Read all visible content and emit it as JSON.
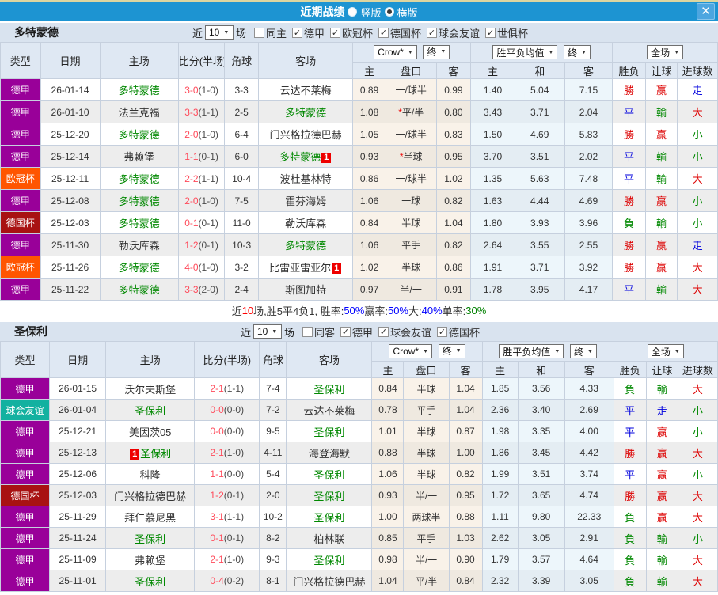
{
  "title_bar": {
    "title": "近期战绩",
    "close_icon": "✕",
    "options": [
      {
        "label": "竖版",
        "selected": false
      },
      {
        "label": "横版",
        "selected": true
      }
    ]
  },
  "columns": {
    "type": "类型",
    "date": "日期",
    "home": "主场",
    "score": "比分(半场)",
    "corner": "角球",
    "away": "客场",
    "crow": "Crow*",
    "end": "终",
    "avg": "胜平负均值",
    "scope": "全场",
    "sub_home": "主",
    "sub_handicap": "盘口",
    "sub_away": "客",
    "sub_avg_home": "主",
    "sub_draw": "和",
    "sub_avg_away": "客",
    "sub_result": "胜负",
    "sub_let": "让球",
    "sub_goals": "进球数"
  },
  "type_colors": {
    "德甲": "#990099",
    "欧冠杯": "#ff5500",
    "德国杯": "#a81212",
    "球会友谊": "#13b1a0"
  },
  "result_colors": {
    "勝": "#dd0000",
    "平": "#0000dd",
    "負": "#008800",
    "赢": "#dd0000",
    "輸": "#008800",
    "走": "#0000dd",
    "大": "#dd0000",
    "小": "#008800"
  },
  "sections": [
    {
      "team": "多特蒙德",
      "filters": {
        "near": "近",
        "count": "10",
        "unit": "场",
        "options": [
          {
            "label": "同主",
            "checked": false
          },
          {
            "label": "德甲",
            "checked": true
          },
          {
            "label": "欧冠杯",
            "checked": true
          },
          {
            "label": "德国杯",
            "checked": true
          },
          {
            "label": "球会友谊",
            "checked": true
          },
          {
            "label": "世俱杯",
            "checked": true
          }
        ]
      },
      "rows": [
        {
          "type": "德甲",
          "date": "26-01-14",
          "home": {
            "name": "多特蒙德",
            "focus": true
          },
          "ft": "3-0",
          "ht": "(1-0)",
          "corner": "3-3",
          "away": {
            "name": "云达不莱梅"
          },
          "crow": [
            "0.89",
            "一/球半",
            "0.99"
          ],
          "avg": [
            "1.40",
            "5.04",
            "7.15"
          ],
          "res": [
            "勝",
            "赢",
            "走"
          ]
        },
        {
          "type": "德甲",
          "date": "26-01-10",
          "home": {
            "name": "法兰克福"
          },
          "ft": "3-3",
          "ht": "(1-1)",
          "corner": "2-5",
          "away": {
            "name": "多特蒙德",
            "focus": true
          },
          "crow": [
            "1.08",
            "*平/半",
            "0.80"
          ],
          "avg": [
            "3.43",
            "3.71",
            "2.04"
          ],
          "res": [
            "平",
            "輸",
            "大"
          ]
        },
        {
          "type": "德甲",
          "date": "25-12-20",
          "home": {
            "name": "多特蒙德",
            "focus": true
          },
          "ft": "2-0",
          "ht": "(1-0)",
          "corner": "6-4",
          "away": {
            "name": "门兴格拉德巴赫"
          },
          "crow": [
            "1.05",
            "一/球半",
            "0.83"
          ],
          "avg": [
            "1.50",
            "4.69",
            "5.83"
          ],
          "res": [
            "勝",
            "赢",
            "小"
          ]
        },
        {
          "type": "德甲",
          "date": "25-12-14",
          "home": {
            "name": "弗赖堡"
          },
          "ft": "1-1",
          "ht": "(0-1)",
          "corner": "6-0",
          "away": {
            "name": "多特蒙德",
            "focus": true,
            "badge": "1",
            "badge_pos": "after"
          },
          "crow": [
            "0.93",
            "*半球",
            "0.95"
          ],
          "avg": [
            "3.70",
            "3.51",
            "2.02"
          ],
          "res": [
            "平",
            "輸",
            "小"
          ]
        },
        {
          "type": "欧冠杯",
          "date": "25-12-11",
          "home": {
            "name": "多特蒙德",
            "focus": true
          },
          "ft": "2-2",
          "ht": "(1-1)",
          "corner": "10-4",
          "away": {
            "name": "波杜基林特"
          },
          "crow": [
            "0.86",
            "一/球半",
            "1.02"
          ],
          "avg": [
            "1.35",
            "5.63",
            "7.48"
          ],
          "res": [
            "平",
            "輸",
            "大"
          ]
        },
        {
          "type": "德甲",
          "date": "25-12-08",
          "home": {
            "name": "多特蒙德",
            "focus": true
          },
          "ft": "2-0",
          "ht": "(1-0)",
          "corner": "7-5",
          "away": {
            "name": "霍芬海姆"
          },
          "crow": [
            "1.06",
            "一球",
            "0.82"
          ],
          "avg": [
            "1.63",
            "4.44",
            "4.69"
          ],
          "res": [
            "勝",
            "赢",
            "小"
          ]
        },
        {
          "type": "德国杯",
          "date": "25-12-03",
          "home": {
            "name": "多特蒙德",
            "focus": true
          },
          "ft": "0-1",
          "ht": "(0-1)",
          "corner": "11-0",
          "away": {
            "name": "勒沃库森"
          },
          "crow": [
            "0.84",
            "半球",
            "1.04"
          ],
          "avg": [
            "1.80",
            "3.93",
            "3.96"
          ],
          "res": [
            "負",
            "輸",
            "小"
          ]
        },
        {
          "type": "德甲",
          "date": "25-11-30",
          "home": {
            "name": "勒沃库森"
          },
          "ft": "1-2",
          "ht": "(0-1)",
          "corner": "10-3",
          "away": {
            "name": "多特蒙德",
            "focus": true
          },
          "crow": [
            "1.06",
            "平手",
            "0.82"
          ],
          "avg": [
            "2.64",
            "3.55",
            "2.55"
          ],
          "res": [
            "勝",
            "赢",
            "走"
          ]
        },
        {
          "type": "欧冠杯",
          "date": "25-11-26",
          "home": {
            "name": "多特蒙德",
            "focus": true
          },
          "ft": "4-0",
          "ht": "(1-0)",
          "corner": "3-2",
          "away": {
            "name": "比雷亚雷亚尔",
            "badge": "1",
            "badge_pos": "after"
          },
          "crow": [
            "1.02",
            "半球",
            "0.86"
          ],
          "avg": [
            "1.91",
            "3.71",
            "3.92"
          ],
          "res": [
            "勝",
            "赢",
            "大"
          ]
        },
        {
          "type": "德甲",
          "date": "25-11-22",
          "home": {
            "name": "多特蒙德",
            "focus": true
          },
          "ft": "3-3",
          "ht": "(2-0)",
          "corner": "2-4",
          "away": {
            "name": "斯图加特"
          },
          "crow": [
            "0.97",
            "半/一",
            "0.91"
          ],
          "avg": [
            "1.78",
            "3.95",
            "4.17"
          ],
          "res": [
            "平",
            "輸",
            "大"
          ]
        }
      ],
      "summary": [
        {
          "t": "近",
          "c": "#333333"
        },
        {
          "t": "10",
          "c": "#ff0000"
        },
        {
          "t": "场,胜5平4负1, 胜率:",
          "c": "#333333"
        },
        {
          "t": "50%",
          "c": "#0000ff"
        },
        {
          "t": " 赢率:",
          "c": "#333333"
        },
        {
          "t": "50%",
          "c": "#0000ff"
        },
        {
          "t": " 大:",
          "c": "#333333"
        },
        {
          "t": "40%",
          "c": "#0000ff"
        },
        {
          "t": " 单率:",
          "c": "#333333"
        },
        {
          "t": "30%",
          "c": "#008000"
        }
      ]
    },
    {
      "team": "圣保利",
      "filters": {
        "near": "近",
        "count": "10",
        "unit": "场",
        "options": [
          {
            "label": "同客",
            "checked": false
          },
          {
            "label": "德甲",
            "checked": true
          },
          {
            "label": "球会友谊",
            "checked": true
          },
          {
            "label": "德国杯",
            "checked": true
          }
        ]
      },
      "rows": [
        {
          "type": "德甲",
          "date": "26-01-15",
          "home": {
            "name": "沃尔夫斯堡"
          },
          "ft": "2-1",
          "ht": "(1-1)",
          "corner": "7-4",
          "away": {
            "name": "圣保利",
            "focus": true
          },
          "crow": [
            "0.84",
            "半球",
            "1.04"
          ],
          "avg": [
            "1.85",
            "3.56",
            "4.33"
          ],
          "res": [
            "負",
            "輸",
            "大"
          ]
        },
        {
          "type": "球会友谊",
          "date": "26-01-04",
          "home": {
            "name": "圣保利",
            "focus": true
          },
          "ft": "0-0",
          "ht": "(0-0)",
          "corner": "7-2",
          "away": {
            "name": "云达不莱梅"
          },
          "crow": [
            "0.78",
            "平手",
            "1.04"
          ],
          "avg": [
            "2.36",
            "3.40",
            "2.69"
          ],
          "res": [
            "平",
            "走",
            "小"
          ]
        },
        {
          "type": "德甲",
          "date": "25-12-21",
          "home": {
            "name": "美因茨05"
          },
          "ft": "0-0",
          "ht": "(0-0)",
          "corner": "9-5",
          "away": {
            "name": "圣保利",
            "focus": true
          },
          "crow": [
            "1.01",
            "半球",
            "0.87"
          ],
          "avg": [
            "1.98",
            "3.35",
            "4.00"
          ],
          "res": [
            "平",
            "赢",
            "小"
          ]
        },
        {
          "type": "德甲",
          "date": "25-12-13",
          "home": {
            "name": "圣保利",
            "focus": true,
            "badge": "1",
            "badge_pos": "before"
          },
          "ft": "2-1",
          "ht": "(1-0)",
          "corner": "4-11",
          "away": {
            "name": "海登海默"
          },
          "crow": [
            "0.88",
            "半球",
            "1.00"
          ],
          "avg": [
            "1.86",
            "3.45",
            "4.42"
          ],
          "res": [
            "勝",
            "赢",
            "大"
          ]
        },
        {
          "type": "德甲",
          "date": "25-12-06",
          "home": {
            "name": "科隆"
          },
          "ft": "1-1",
          "ht": "(0-0)",
          "corner": "5-4",
          "away": {
            "name": "圣保利",
            "focus": true
          },
          "crow": [
            "1.06",
            "半球",
            "0.82"
          ],
          "avg": [
            "1.99",
            "3.51",
            "3.74"
          ],
          "res": [
            "平",
            "赢",
            "小"
          ]
        },
        {
          "type": "德国杯",
          "date": "25-12-03",
          "home": {
            "name": "门兴格拉德巴赫"
          },
          "ft": "1-2",
          "ht": "(0-1)",
          "corner": "2-0",
          "away": {
            "name": "圣保利",
            "focus": true
          },
          "crow": [
            "0.93",
            "半/一",
            "0.95"
          ],
          "avg": [
            "1.72",
            "3.65",
            "4.74"
          ],
          "res": [
            "勝",
            "赢",
            "大"
          ]
        },
        {
          "type": "德甲",
          "date": "25-11-29",
          "home": {
            "name": "拜仁慕尼黑"
          },
          "ft": "3-1",
          "ht": "(1-1)",
          "corner": "10-2",
          "away": {
            "name": "圣保利",
            "focus": true
          },
          "crow": [
            "1.00",
            "两球半",
            "0.88"
          ],
          "avg": [
            "1.11",
            "9.80",
            "22.33"
          ],
          "res": [
            "負",
            "赢",
            "大"
          ]
        },
        {
          "type": "德甲",
          "date": "25-11-24",
          "home": {
            "name": "圣保利",
            "focus": true
          },
          "ft": "0-1",
          "ht": "(0-1)",
          "corner": "8-2",
          "away": {
            "name": "柏林联"
          },
          "crow": [
            "0.85",
            "平手",
            "1.03"
          ],
          "avg": [
            "2.62",
            "3.05",
            "2.91"
          ],
          "res": [
            "負",
            "輸",
            "小"
          ]
        },
        {
          "type": "德甲",
          "date": "25-11-09",
          "home": {
            "name": "弗赖堡"
          },
          "ft": "2-1",
          "ht": "(1-0)",
          "corner": "9-3",
          "away": {
            "name": "圣保利",
            "focus": true
          },
          "crow": [
            "0.98",
            "半/一",
            "0.90"
          ],
          "avg": [
            "1.79",
            "3.57",
            "4.64"
          ],
          "res": [
            "負",
            "輸",
            "大"
          ]
        },
        {
          "type": "德甲",
          "date": "25-11-01",
          "home": {
            "name": "圣保利",
            "focus": true
          },
          "ft": "0-4",
          "ht": "(0-2)",
          "corner": "8-1",
          "away": {
            "name": "门兴格拉德巴赫"
          },
          "crow": [
            "1.04",
            "平/半",
            "0.84"
          ],
          "avg": [
            "2.32",
            "3.39",
            "3.05"
          ],
          "res": [
            "負",
            "輸",
            "大"
          ]
        }
      ],
      "summary": null
    }
  ]
}
